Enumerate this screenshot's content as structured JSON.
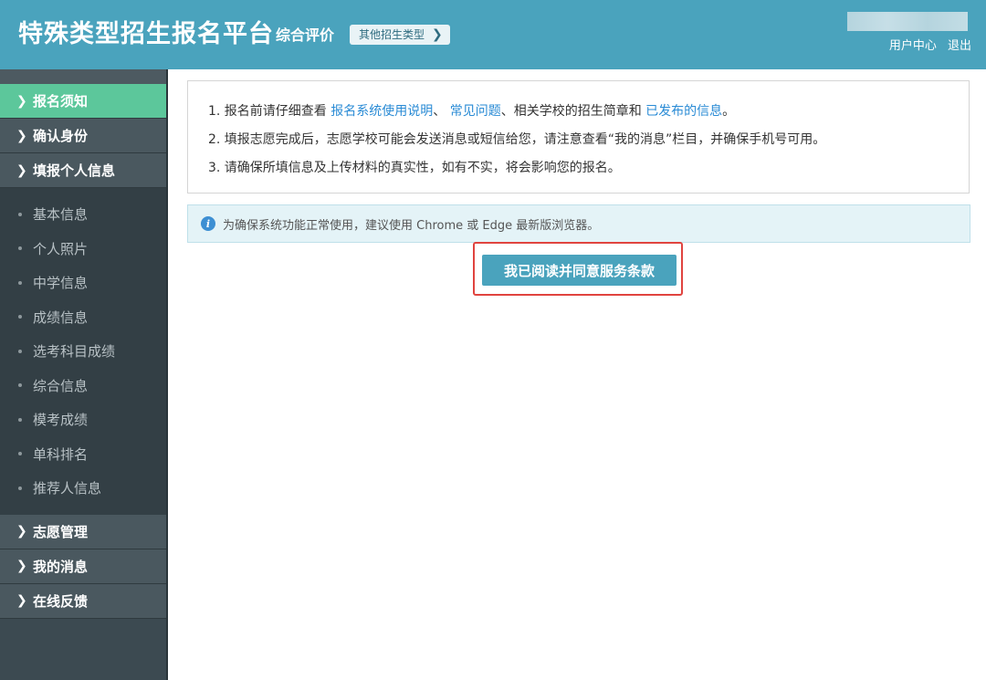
{
  "header": {
    "app_title": "特殊类型招生报名平台",
    "subtitle": "综合评价",
    "type_switch_label": "其他招生类型",
    "user_center": "用户中心",
    "logout": "退出"
  },
  "sidebar": {
    "top_items": [
      {
        "label": "报名须知",
        "active": true
      },
      {
        "label": "确认身份"
      },
      {
        "label": "填报个人信息"
      }
    ],
    "sub_items": [
      "基本信息",
      "个人照片",
      "中学信息",
      "成绩信息",
      "选考科目成绩",
      "综合信息",
      "模考成绩",
      "单科排名",
      "推荐人信息"
    ],
    "bottom_items": [
      {
        "label": "志愿管理"
      },
      {
        "label": "我的消息"
      },
      {
        "label": "在线反馈"
      }
    ]
  },
  "notice": {
    "line1": {
      "prefix": "1. 报名前请仔细查看 ",
      "link1": "报名系统使用说明",
      "sep1": "、 ",
      "link2": "常见问题",
      "mid": "、相关学校的招生简章和 ",
      "link3": "已发布的信息",
      "end": "。"
    },
    "line2": "2. 填报志愿完成后，志愿学校可能会发送消息或短信给您，请注意查看“我的消息”栏目，并确保手机号可用。",
    "line3": "3. 请确保所填信息及上传材料的真实性，如有不实，将会影响您的报名。"
  },
  "browser_tip": "为确保系统功能正常使用，建议使用 Chrome 或 Edge 最新版浏览器。",
  "agree_button": "我已阅读并同意服务条款",
  "colors": {
    "header_bg": "#4aa3bd",
    "sidebar_bg": "#3c4a51",
    "active_item": "#5cc79b",
    "link": "#2a8bd5",
    "highlight_border": "#e0443f"
  }
}
